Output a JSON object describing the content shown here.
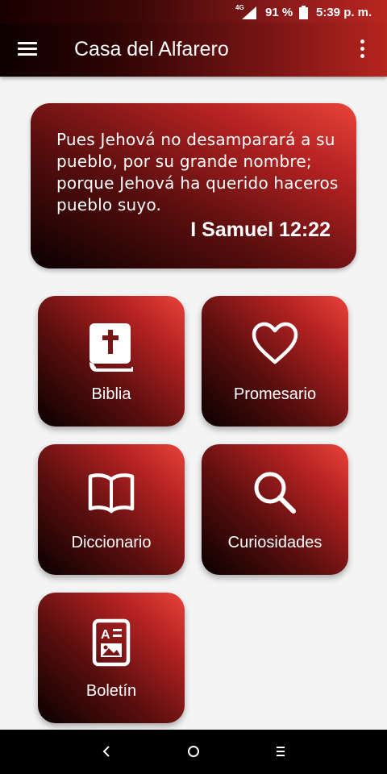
{
  "status_bar": {
    "network": "4G",
    "battery_percent": "91 %",
    "time": "5:39 p. m."
  },
  "app_bar": {
    "title": "Casa del Alfarero",
    "menu_icon": "hamburger-menu-icon",
    "overflow_icon": "more-vert-icon"
  },
  "verse": {
    "text": "Pues Jehová no desamparará a su pueblo, por su grande nombre; porque Jehová ha querido haceros pueblo suyo.",
    "reference": "I Samuel 12:22"
  },
  "tiles": [
    {
      "label": "Biblia",
      "icon": "bible-icon"
    },
    {
      "label": "Promesario",
      "icon": "heart-icon"
    },
    {
      "label": "Diccionario",
      "icon": "open-book-icon"
    },
    {
      "label": "Curiosidades",
      "icon": "search-icon"
    },
    {
      "label": "Boletín",
      "icon": "newsletter-icon"
    }
  ],
  "colors": {
    "gradient_dark": "#0a0000",
    "gradient_mid": "#b42222",
    "gradient_light": "#e8433a",
    "background": "#f4f4f4"
  },
  "nav_bar": {
    "back_icon": "back-icon",
    "home_icon": "home-icon",
    "recents_icon": "recents-icon"
  }
}
